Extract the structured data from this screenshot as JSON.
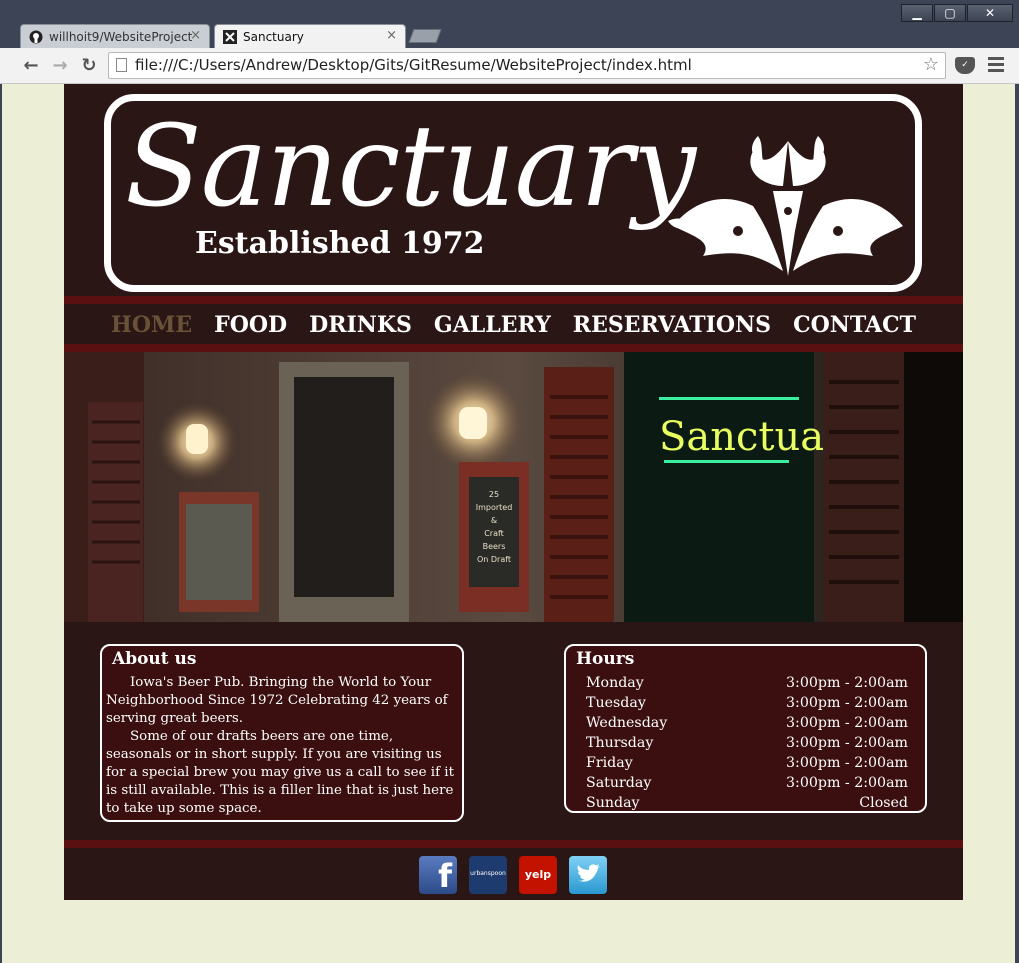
{
  "browser": {
    "tabs": [
      {
        "label": "willhoit9/WebsiteProject"
      },
      {
        "label": "Sanctuary"
      }
    ],
    "tab_close_glyph": "×",
    "url": "file:///C:/Users/Andrew/Desktop/Gits/GitResume/WebsiteProject/index.html",
    "window_controls": {
      "minimize": "▁",
      "maximize": "▢",
      "close": "✕"
    },
    "nav": {
      "back": "←",
      "forward": "→",
      "reload": "↻"
    },
    "star_glyph": "☆"
  },
  "site": {
    "logo": {
      "name": "Sanctuary",
      "established": "Established 1972"
    },
    "nav": [
      {
        "label": "HOME",
        "current": true
      },
      {
        "label": "FOOD"
      },
      {
        "label": "DRINKS"
      },
      {
        "label": "GALLERY"
      },
      {
        "label": "RESERVATIONS"
      },
      {
        "label": "CONTACT"
      }
    ],
    "hero": {
      "sign_text": "Sanctuar",
      "board_text": [
        "25",
        "Imported",
        "&",
        "Craft",
        "Beers",
        "On Draft"
      ]
    },
    "about": {
      "heading": "About us",
      "paragraphs": [
        "Iowa's Beer Pub. Bringing the World to Your Neighborhood Since 1972 Celebrating 42 years of serving great beers.",
        "Some of our drafts beers are one time, seasonals or in short supply. If you are visiting us for a special brew you may give us a call to see if it is still available. This is a filler line that is just here to take up some space."
      ]
    },
    "hours": {
      "heading": "Hours",
      "rows": [
        {
          "day": "Monday",
          "time": "3:00pm - 2:00am"
        },
        {
          "day": "Tuesday",
          "time": "3:00pm - 2:00am"
        },
        {
          "day": "Wednesday",
          "time": "3:00pm - 2:00am"
        },
        {
          "day": "Thursday",
          "time": "3:00pm - 2:00am"
        },
        {
          "day": "Friday",
          "time": "3:00pm - 2:00am"
        },
        {
          "day": "Saturday",
          "time": "3:00pm - 2:00am"
        },
        {
          "day": "Sunday",
          "time": "Closed"
        }
      ]
    },
    "social": [
      {
        "name": "facebook-icon",
        "glyph": "f",
        "color": "#3b5998"
      },
      {
        "name": "urbanspoon-icon",
        "glyph": "urbanspoon",
        "color": "#1d3b6e"
      },
      {
        "name": "yelp-icon",
        "glyph": "yelp",
        "color": "#c41200"
      },
      {
        "name": "twitter-icon",
        "glyph": "",
        "color": "#3ea9dd"
      }
    ]
  },
  "colors": {
    "page_bg": "#ecefd6",
    "site_bg": "#2a1614",
    "accent_band": "#5a0f10",
    "box_bg": "#3b0f0f",
    "nav_current": "#6a5238"
  }
}
